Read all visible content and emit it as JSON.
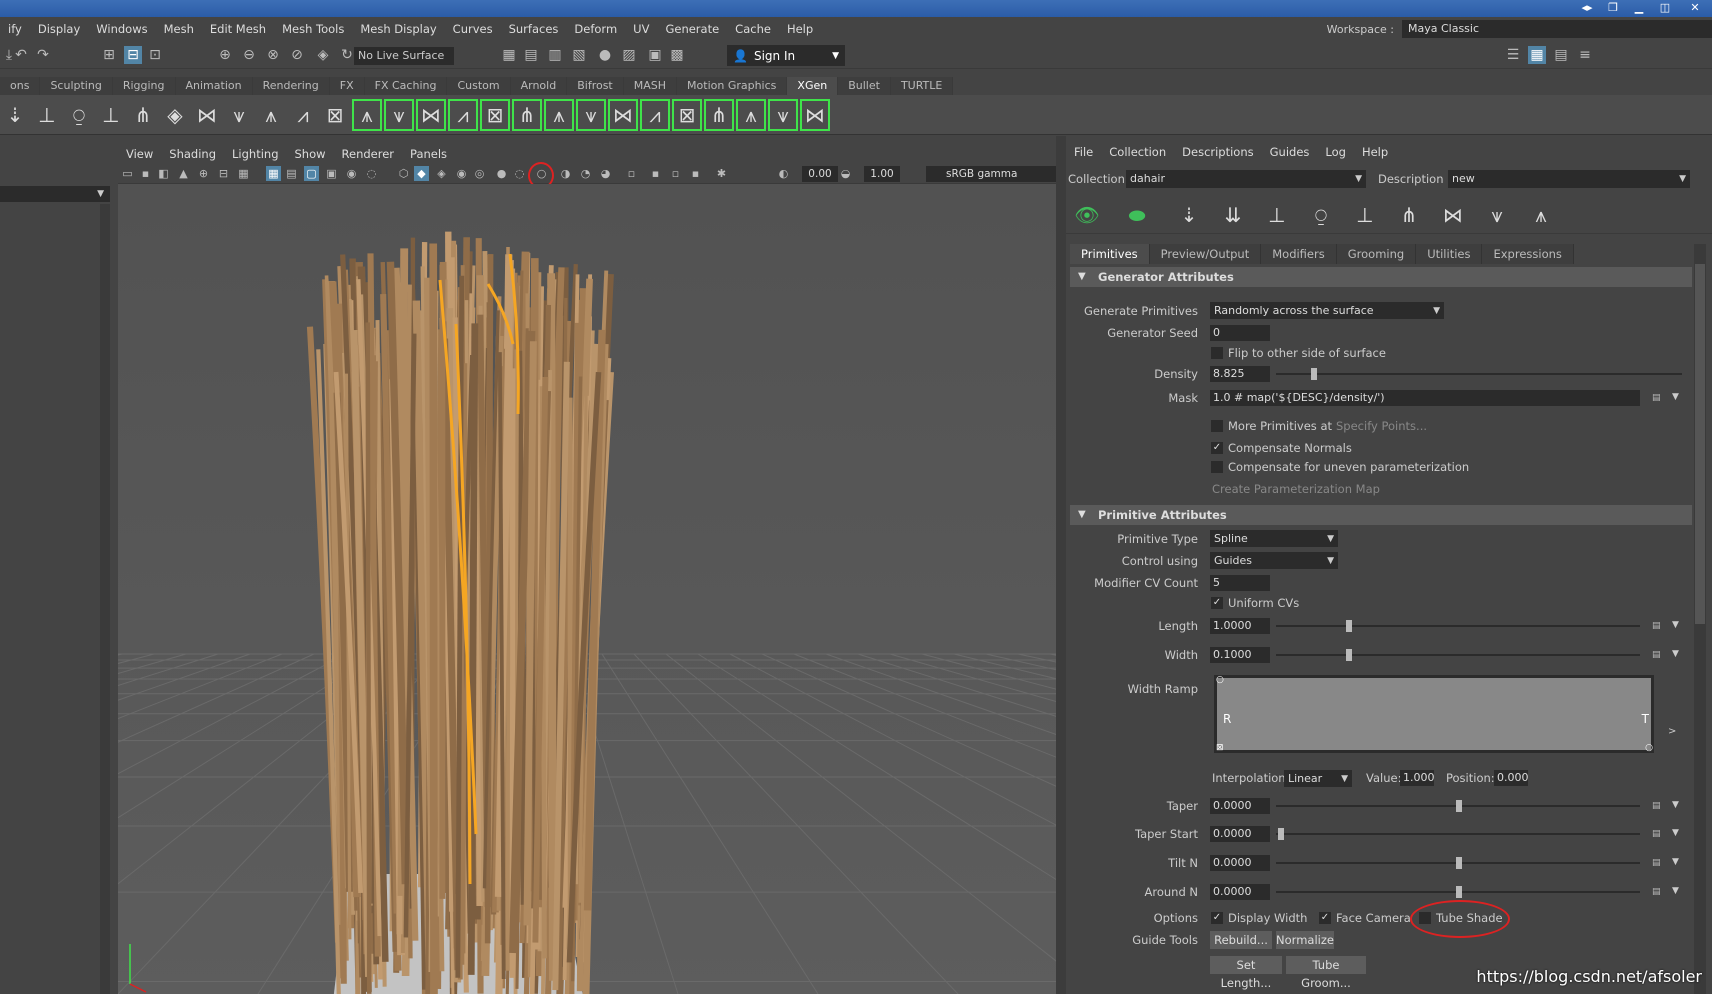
{
  "menubar": {
    "items": [
      "ify",
      "Display",
      "Windows",
      "Mesh",
      "Edit Mesh",
      "Mesh Tools",
      "Mesh Display",
      "Curves",
      "Surfaces",
      "Deform",
      "UV",
      "Generate",
      "Cache",
      "Help"
    ]
  },
  "workspace": {
    "label": "Workspace :",
    "value": "Maya Classic"
  },
  "statusline": {
    "live_surface": "No Live Surface",
    "sign_in": "Sign In"
  },
  "shelf": {
    "tabs": [
      "ons",
      "Sculpting",
      "Rigging",
      "Animation",
      "Rendering",
      "FX",
      "FX Caching",
      "Custom",
      "Arnold",
      "Bifrost",
      "MASH",
      "Motion Graphics",
      "XGen",
      "Bullet",
      "TURTLE"
    ],
    "active_tab": "XGen"
  },
  "viewport": {
    "menu": [
      "View",
      "Shading",
      "Lighting",
      "Show",
      "Renderer",
      "Panels"
    ],
    "exposure": "0.00",
    "gamma": "1.00",
    "color_space": "sRGB gamma"
  },
  "xgen": {
    "menu": [
      "File",
      "Collection",
      "Descriptions",
      "Guides",
      "Log",
      "Help"
    ],
    "collection_label": "Collection",
    "collection_value": "dahair",
    "description_label": "Description",
    "description_value": "new",
    "tabs": [
      "Primitives",
      "Preview/Output",
      "Modifiers",
      "Grooming",
      "Utilities",
      "Expressions"
    ],
    "active_tab": "Primitives",
    "generator": {
      "header": "Generator Attributes",
      "generate_primitives_label": "Generate Primitives",
      "generate_primitives_value": "Randomly across the surface",
      "seed_label": "Generator Seed",
      "seed_value": "0",
      "flip_label": "Flip to other side of surface",
      "density_label": "Density",
      "density_value": "8.825",
      "mask_label": "Mask",
      "mask_value": "1.0 # map('${DESC}/density/')",
      "more_primitives_label": "More Primitives at",
      "specify_points": "Specify Points...",
      "compensate_normals": "Compensate Normals",
      "compensate_uneven": "Compensate for uneven parameterization",
      "create_param_map": "Create Parameterization Map"
    },
    "primitive": {
      "header": "Primitive Attributes",
      "type_label": "Primitive Type",
      "type_value": "Spline",
      "control_label": "Control using",
      "control_value": "Guides",
      "cv_count_label": "Modifier CV Count",
      "cv_count_value": "5",
      "uniform_cvs": "Uniform CVs",
      "length_label": "Length",
      "length_value": "1.0000",
      "width_label": "Width",
      "width_value": "0.1000",
      "width_ramp_label": "Width Ramp",
      "ramp_left": "R",
      "ramp_right": "T",
      "interpolation_label": "Interpolation:",
      "interpolation_value": "Linear",
      "value_label": "Value:",
      "value_value": "1.000",
      "position_label": "Position:",
      "position_value": "0.000",
      "taper_label": "Taper",
      "taper_value": "0.0000",
      "taper_start_label": "Taper Start",
      "taper_start_value": "0.0000",
      "tilt_label": "Tilt N",
      "tilt_value": "0.0000",
      "around_label": "Around N",
      "around_value": "0.0000",
      "options_label": "Options",
      "display_width": "Display Width",
      "face_camera": "Face Camera",
      "tube_shade": "Tube Shade",
      "guide_tools_label": "Guide Tools",
      "rebuild": "Rebuild...",
      "normalize": "Normalize",
      "set_length": "Set Length...",
      "tube_groom": "Tube Groom..."
    }
  },
  "watermark": "https://blog.csdn.net/afsoler",
  "colors": {
    "titlebar": "#2b5ca8",
    "highlight": "#5285a6",
    "shelf_frame": "#3fe34a",
    "annotation": "#dd2222",
    "hair": "#a47f57",
    "guide": "#f5a623"
  }
}
